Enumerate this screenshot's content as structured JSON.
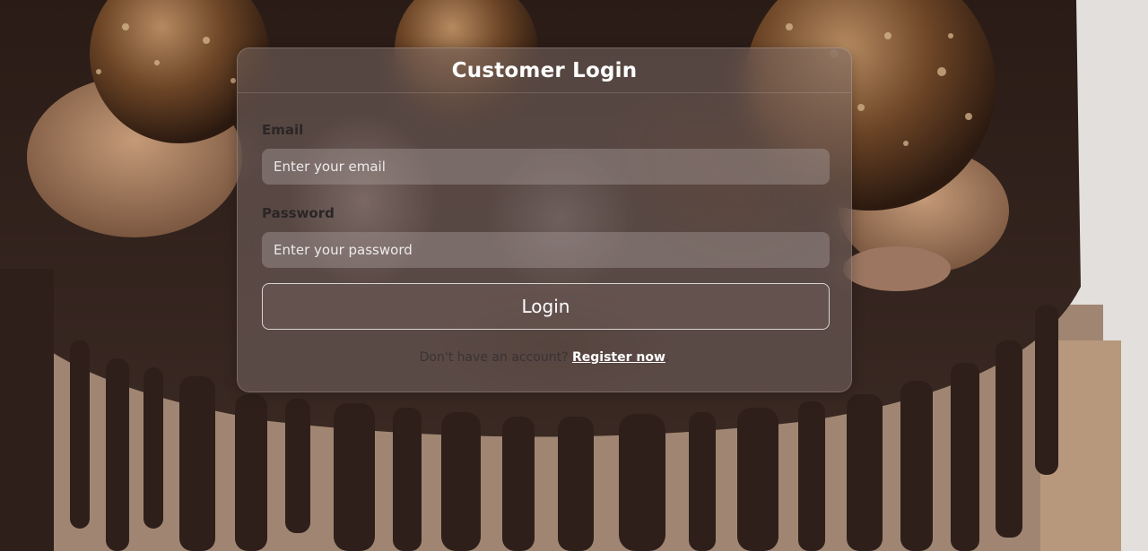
{
  "login_card": {
    "title": "Customer Login",
    "email": {
      "label": "Email",
      "value": "",
      "placeholder": "Enter your email"
    },
    "password": {
      "label": "Password",
      "value": "",
      "placeholder": "Enter your password"
    },
    "submit_label": "Login",
    "register_prompt": "Don't have an account?",
    "register_link": "Register now",
    "register_suffix": "."
  },
  "colors": {
    "card_background": "#786864",
    "title_text": "#ffffff",
    "label_text": "#2b2626",
    "button_border": "#ffffff"
  }
}
